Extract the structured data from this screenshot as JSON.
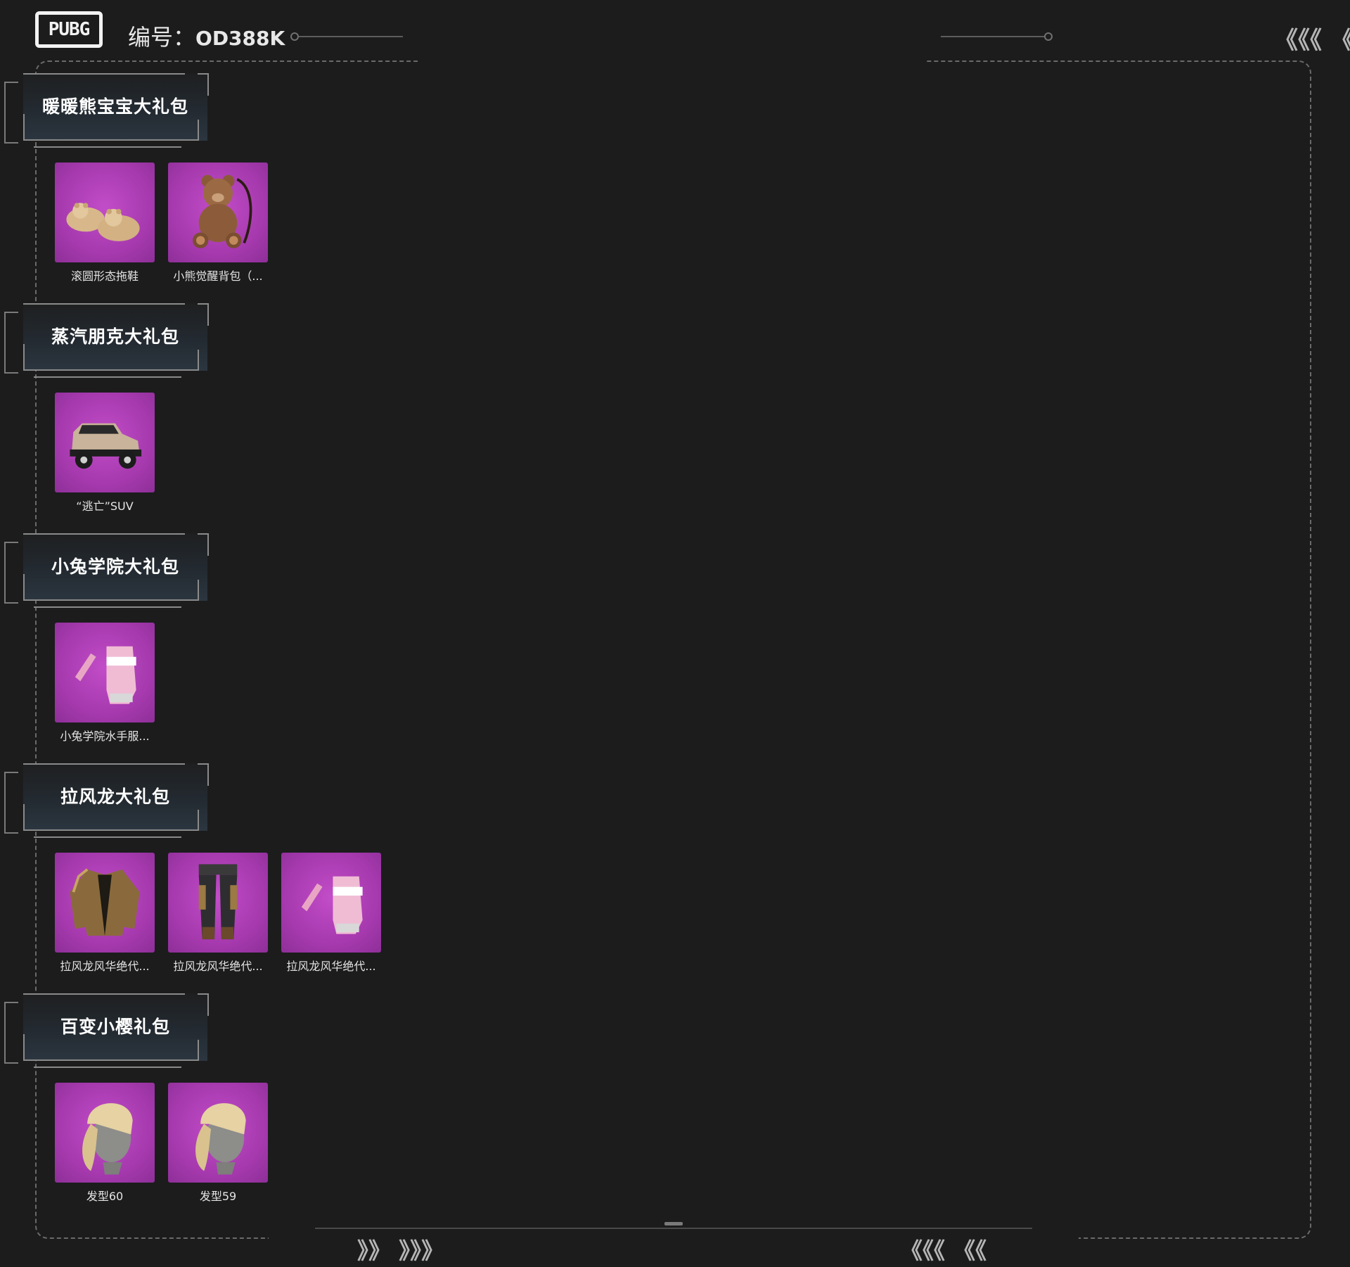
{
  "header": {
    "logo_text": "PUBG",
    "id_label": "编号：",
    "id_value": "OD388K",
    "chevrons_top_right": "《《《 《",
    "chevrons_bottom_left": "》》 》》》",
    "chevrons_bottom_right": "《《《 《《"
  },
  "sections": [
    {
      "title": "暖暖熊宝宝大礼包",
      "items": [
        {
          "name": "滚圆形态拖鞋",
          "icon": "slippers-icon"
        },
        {
          "name": "小熊觉醒背包（...",
          "icon": "teddy-backpack-icon"
        }
      ]
    },
    {
      "title": "蒸汽朋克大礼包",
      "items": [
        {
          "name": "“逃亡”SUV",
          "icon": "car-icon"
        }
      ]
    },
    {
      "title": "小兔学院大礼包",
      "items": [
        {
          "name": "小兔学院水手服...",
          "icon": "gloves-icon"
        }
      ]
    },
    {
      "title": "拉风龙大礼包",
      "items": [
        {
          "name": "拉风龙风华绝代...",
          "icon": "jacket-icon"
        },
        {
          "name": "拉风龙风华绝代...",
          "icon": "pants-icon"
        },
        {
          "name": "拉风龙风华绝代...",
          "icon": "gloves-icon"
        }
      ]
    },
    {
      "title": "百变小樱礼包",
      "items": [
        {
          "name": "发型60",
          "icon": "hairstyle-icon"
        },
        {
          "name": "发型59",
          "icon": "hairstyle-icon"
        }
      ]
    }
  ],
  "colors": {
    "background": "#1c1c1d",
    "item_bg": "#a73aaf",
    "frame": "#6a6a6a"
  }
}
